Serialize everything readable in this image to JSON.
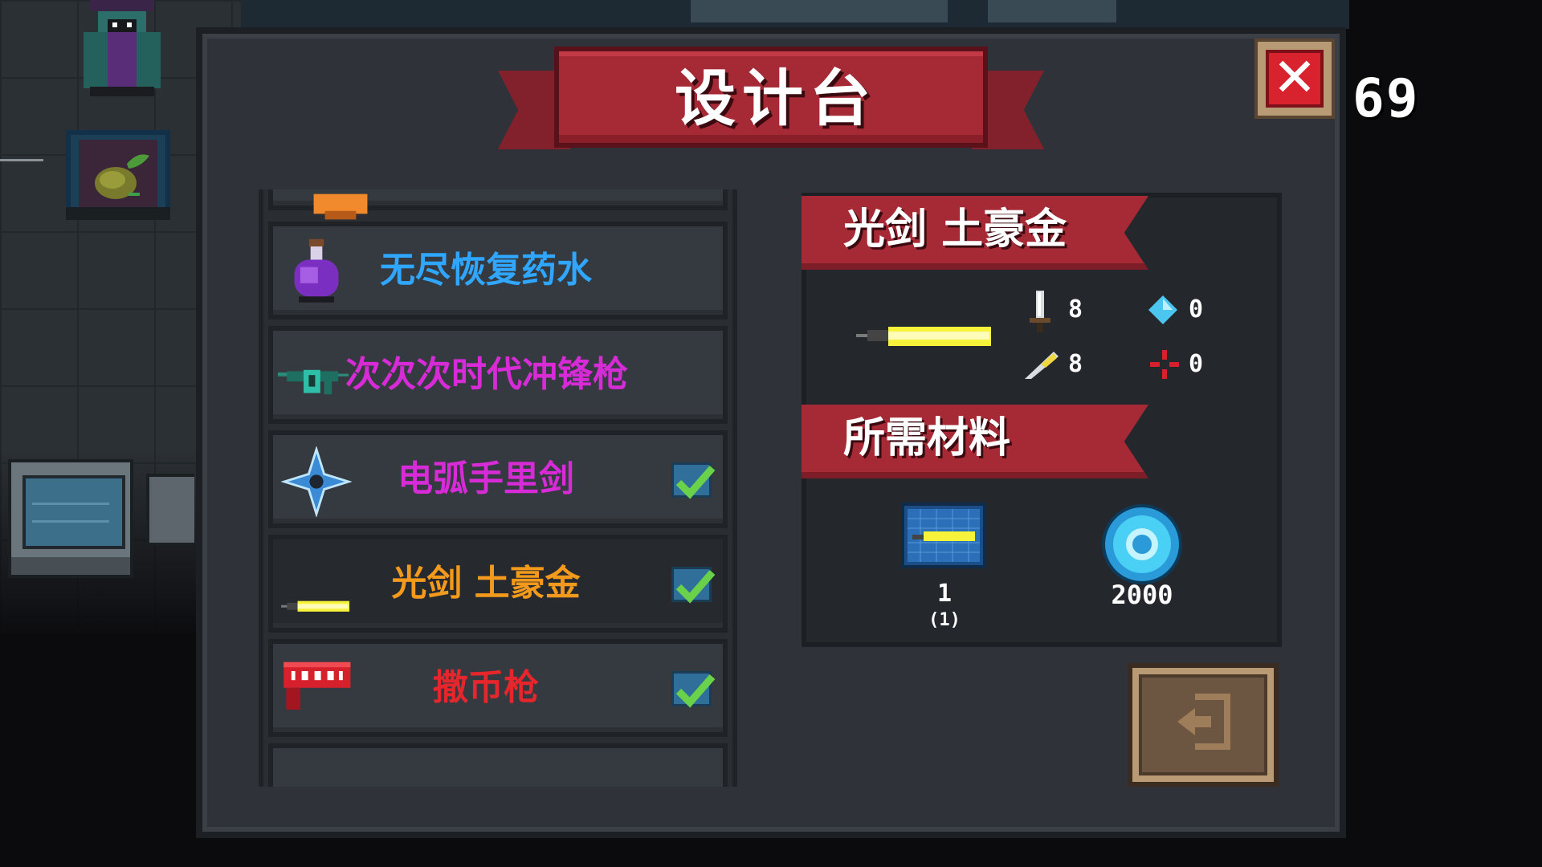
{
  "window": {
    "title": "设计台",
    "close_icon": "close-x-icon",
    "counter": "69"
  },
  "list": {
    "items": [
      {
        "label": "",
        "color": "#f08a2c",
        "icon": "orange-item-icon",
        "checked": false,
        "partial": "top"
      },
      {
        "label": "无尽恢复药水",
        "color": "#2fa6ff",
        "icon": "purple-potion-icon",
        "checked": false
      },
      {
        "label": "次次次时代冲锋枪",
        "color": "#d62bd6",
        "icon": "smg-icon",
        "checked": false
      },
      {
        "label": "电弧手里剑",
        "color": "#d62bd6",
        "icon": "shuriken-icon",
        "checked": true
      },
      {
        "label": "光剑 土豪金",
        "color": "#f39a1c",
        "icon": "lightsaber-icon",
        "checked": true,
        "selected": true
      },
      {
        "label": "撒币枪",
        "color": "#e5262d",
        "icon": "coin-gun-icon",
        "checked": true
      },
      {
        "label": "",
        "color": "#e5262d",
        "icon": "blue-item-icon",
        "checked": false,
        "partial": "bottom"
      }
    ]
  },
  "detail": {
    "name": "光剑 土豪金",
    "weapon_icon": "lightsaber-icon",
    "stats": {
      "damage": {
        "icon": "sword-icon",
        "value": "8"
      },
      "energy": {
        "icon": "diamond-icon",
        "value": "0"
      },
      "attack_speed": {
        "icon": "feather-icon",
        "value": "8"
      },
      "accuracy": {
        "icon": "crosshair-icon",
        "value": "0"
      }
    },
    "materials_title": "所需材料",
    "materials": [
      {
        "icon": "blueprint-icon",
        "count": "1",
        "owned": "(1)"
      },
      {
        "icon": "gem-coin-icon",
        "count": "2000"
      }
    ]
  },
  "exit_icon": "exit-door-icon",
  "colors": {
    "panel": "#2f3339",
    "banner": "#a52a35",
    "accent_gold": "#f39a1c"
  }
}
